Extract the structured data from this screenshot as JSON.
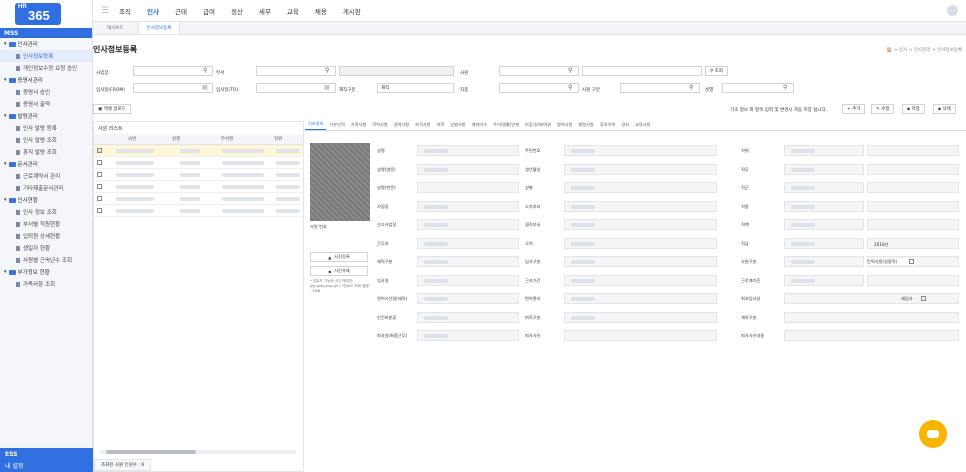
{
  "brand": {
    "small": "HR",
    "big": "365"
  },
  "sidebar": {
    "header": "MSS",
    "groups": [
      {
        "label": "인사관리",
        "items": [
          "인사정보등록",
          "개인정보수정 요청 승인"
        ]
      },
      {
        "label": "증명서관리",
        "items": [
          "증명서 승인",
          "증명서 출력"
        ]
      },
      {
        "label": "발령관리",
        "items": [
          "인사 발령 등록",
          "인사 발령 조회",
          "휴직 발령 조회"
        ]
      },
      {
        "label": "문서관리",
        "items": [
          "근로계약서 관리",
          "기타제출문서관리"
        ]
      },
      {
        "label": "인사현황",
        "items": [
          "인사 정보 조회",
          "부서별 직원현황",
          "입퇴원 상세현황",
          "생일자 현황",
          "사원별 근속년수 조회"
        ]
      },
      {
        "label": "부가정보 현황",
        "items": [
          "가족사항 조회"
        ]
      }
    ],
    "footer": "ESS",
    "footer2": "내 설정"
  },
  "topnav": [
    "조직",
    "인사",
    "근태",
    "급여",
    "정산",
    "세무",
    "교육",
    "채용",
    "게시판"
  ],
  "tabs": [
    "대시보드",
    "인사정보등록"
  ],
  "page": {
    "title": "인사정보등록",
    "breadcrumb": "🏠 > 인사 > 인사관리 > 인사정보등록"
  },
  "search": {
    "site": "사업장",
    "dept": "부서",
    "emp": "사원",
    "hire_from": "입사일(FROM)",
    "hire_to": "입사일(TO)",
    "status": "재직구분",
    "status_val": "재직",
    "duty": "직종",
    "emp_type": "사원 구분",
    "gender": "성별",
    "btn_find": "조회"
  },
  "toolbar": {
    "excel": "엑셀 업로드",
    "notice": "기초 정보 외 항목 입력 및 변경시 자동 저장 됩니다.",
    "add": "추가",
    "edit": "수정",
    "save": "저장",
    "delete": "삭제"
  },
  "list": {
    "title": "사원 리스트",
    "cols": [
      "사번",
      "성명",
      "부서명",
      "직위"
    ],
    "footer": "조회된 사원 인원수 : 6"
  },
  "detail": {
    "tabs": [
      "기초정보",
      "기본인적",
      "가족사항",
      "학력사항",
      "경력사항",
      "자격사항",
      "어학",
      "상벌사항",
      "계약이수",
      "주거/생활/인재",
      "보훈/장애/여권",
      "병역사항",
      "발령사항",
      "휴직이력",
      "경지",
      "교육사항"
    ],
    "photo_label": "사원 번호",
    "photo_reg": "사진등록",
    "photo_del": "사진삭제",
    "photo_note": "* 업로드 가능한 사진 확장자: jpg,jpeg,png,gif / *업로드 최대 용량 : 5MB",
    "fields": {
      "name": "성명",
      "name_en": "성명(영문)",
      "name_cn": "성명(한문)",
      "site": "사업장",
      "report_site": "신고사업장",
      "workplace": "근무지",
      "emp_class": "재직구분",
      "hire": "입사일",
      "prev_start": "면허기산일(재직)",
      "personnel": "인건비분류",
      "retire": "퇴사일(최종근무)",
      "resident": "주민번호",
      "birth": "생년월일",
      "gender": "성별",
      "dept": "소속부서",
      "concurrent": "겸직부서",
      "nation": "국적",
      "hire_type": "입사구분",
      "tenure": "근속기간",
      "certified": "면허관리",
      "pay_type": "퇴직구분",
      "retire_reason": "퇴사사유",
      "position": "직위",
      "title": "직무",
      "grade": "직군",
      "job": "직종",
      "rank": "직책",
      "level": "직급",
      "level_val": "2018년",
      "emp_type": "사원구분",
      "contract_start": "근로계기준",
      "probation": "최초입사일",
      "contract_type": "계약구분",
      "retire_note": "퇴사사유내용",
      "short_time": "탄력사원(일용직)",
      "sched": "재입사"
    }
  },
  "colors": {
    "accent": "#2f6fe0",
    "chat": "#f7b500"
  }
}
